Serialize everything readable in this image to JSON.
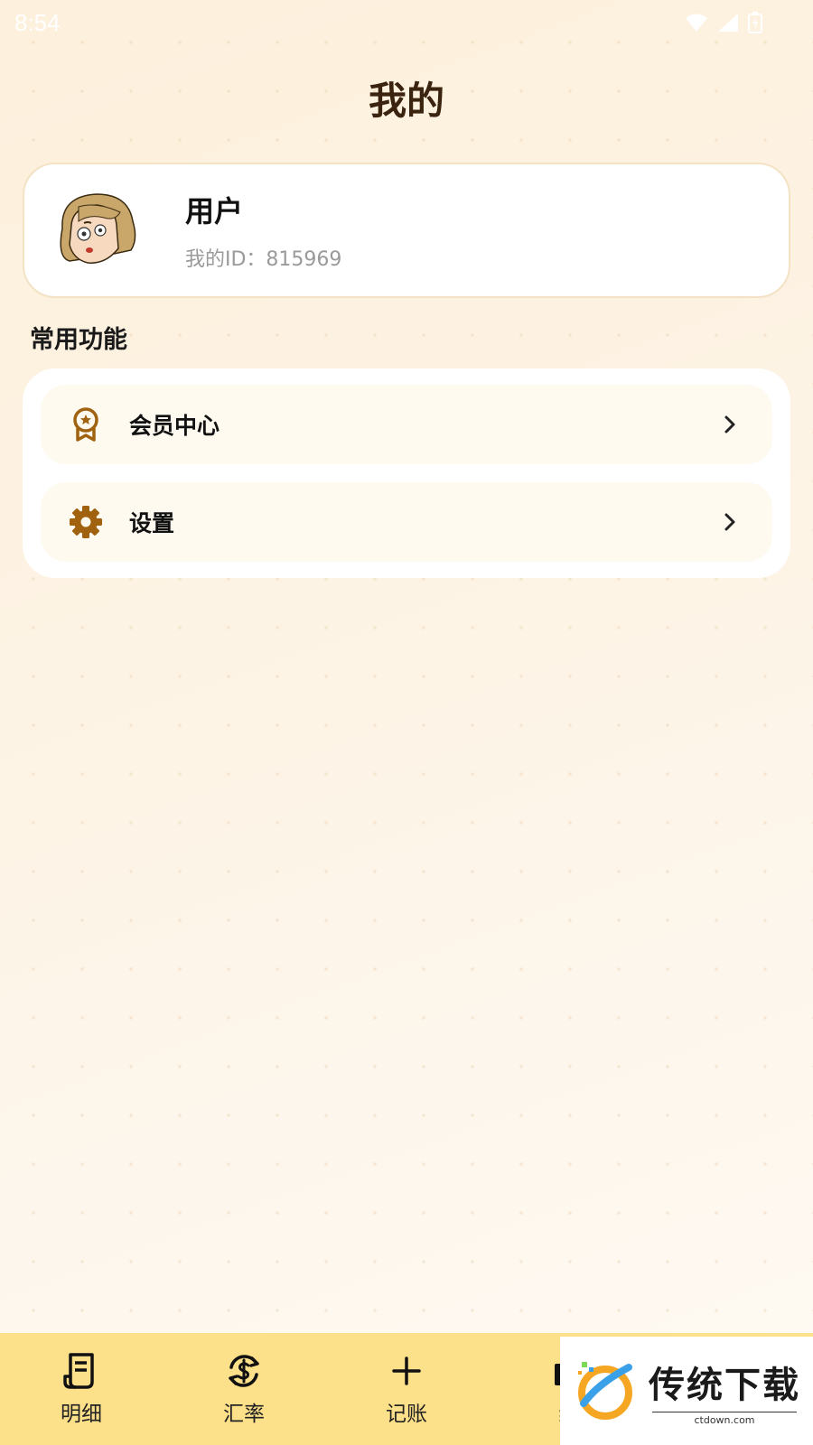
{
  "status_bar": {
    "time": "8:54",
    "icons": [
      "wifi-icon",
      "signal-icon",
      "battery-charging-icon"
    ]
  },
  "page": {
    "title": "我的"
  },
  "profile": {
    "username": "用户",
    "user_id": "我的ID：815969",
    "avatar": "cartoon-avatar"
  },
  "common_functions": {
    "title": "常用功能",
    "items": [
      {
        "label": "会员中心",
        "icon": "badge-icon"
      },
      {
        "label": "设置",
        "icon": "gear-icon"
      }
    ]
  },
  "tab_bar": {
    "tabs": [
      {
        "label": "明细",
        "icon": "receipt-icon"
      },
      {
        "label": "汇率",
        "icon": "exchange-icon"
      },
      {
        "label": "记账",
        "icon": "plus-icon"
      },
      {
        "label": "统",
        "icon": "chart-icon"
      }
    ]
  },
  "watermark": {
    "title": "传统下载",
    "subtitle": "ctdown.com"
  },
  "colors": {
    "accent": "#a0620f",
    "tab_bar_bg": "#fde08a",
    "title_text": "#3a2410"
  }
}
